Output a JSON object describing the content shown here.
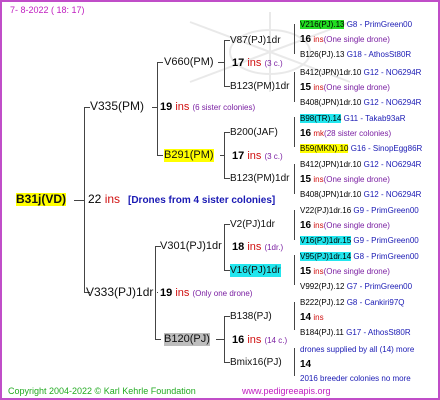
{
  "header_date": "7- 8-2022 ( 18: 17)",
  "copyright": "Copyright 2004-2022 © Karl Kehrle Foundation",
  "site_url": "www.pedigreeapis.org",
  "root": {
    "label": "B31j(VD)",
    "ins": "22",
    "ins_word": "ins",
    "note": "[Drones from 4 sister colonies]"
  },
  "sire": {
    "label": "V335(PM)",
    "ins": "19",
    "ins_word": "ins",
    "note": "(6 sister colonies)"
  },
  "dam": {
    "label": "V333(PJ)1dr",
    "ins": "19",
    "ins_word": "ins",
    "note": "(Only one drone)"
  },
  "ss": {
    "label": "V660(PM)",
    "ins": "17",
    "ins_word": "ins",
    "note": "(3 c.)"
  },
  "sd": {
    "label": "B291(PM)",
    "ins": "17",
    "ins_word": "ins",
    "note": "(3 c.)"
  },
  "ds": {
    "label": "V301(PJ)1dr",
    "ins": "18",
    "ins_word": "ins",
    "note": "(1dr.)"
  },
  "dd": {
    "label": "B120(PJ)",
    "ins": "16",
    "ins_word": "ins",
    "note": "(14 c.)"
  },
  "l3": {
    "v87": "V87(PJ)1dr",
    "b123a": "B123(PM)1dr",
    "b200": "B200(JAF)",
    "b123b": "B123(PM)1dr",
    "v2": "V2(PJ)1dr",
    "v16": "V16(PJ)1dr",
    "b138": "B138(PJ)",
    "bmix": "Bmix16(PJ)"
  },
  "l4": [
    {
      "name": "V216(PJ).13",
      "info": "G8 - PrimGreen00"
    },
    {
      "ins": "16",
      "word": "ins",
      "note": "(One single drone)"
    },
    {
      "name": "B126(PJ).13",
      "info": "G18 - AthosSt80R"
    },
    {
      "name": "B412(JPN)1dr.10",
      "info": "G12 - NO6294R"
    },
    {
      "ins": "15",
      "word": "ins",
      "note": "(One single drone)"
    },
    {
      "name": "B408(JPN)1dr.10",
      "info": "G12 - NO6294R"
    },
    {
      "name": "B98(TR).14",
      "info": "G11 - Takab93aR"
    },
    {
      "ins": "16",
      "word": "mk",
      "note": "(28 sister colonies)"
    },
    {
      "name": "B59(MKN).10",
      "info": "G16 - SinopEgg86R"
    },
    {
      "name": "B412(JPN)1dr.10",
      "info": "G12 - NO6294R"
    },
    {
      "ins": "15",
      "word": "ins",
      "note": "(One single drone)"
    },
    {
      "name": "B408(JPN)1dr.10",
      "info": "G12 - NO6294R"
    },
    {
      "name": "V22(PJ)1dr.16",
      "info": "G9 - PrimGreen00"
    },
    {
      "ins": "16",
      "word": "ins",
      "note": "(One single drone)"
    },
    {
      "name": "V16(PJ)1dr.15",
      "info": "G9 - PrimGreen00"
    },
    {
      "name": "V95(PJ)1dr.14",
      "info": "G8 - PrimGreen00"
    },
    {
      "ins": "15",
      "word": "ins",
      "note": "(One single drone)"
    },
    {
      "name": "V992(PJ).12",
      "info": "G7 - PrimGreen00"
    },
    {
      "name": "B222(PJ).12",
      "info": "G8 - Cankiri97Q"
    },
    {
      "ins": "14",
      "word": "ins",
      "note": ""
    },
    {
      "name": "B184(PJ).11",
      "info": "G17 - AthosSt80R"
    },
    {
      "text": "drones supplied by all (14) more"
    },
    {
      "ins": "14",
      "word": "",
      "note": ""
    },
    {
      "text": "2016 breeder colonies no more"
    }
  ]
}
